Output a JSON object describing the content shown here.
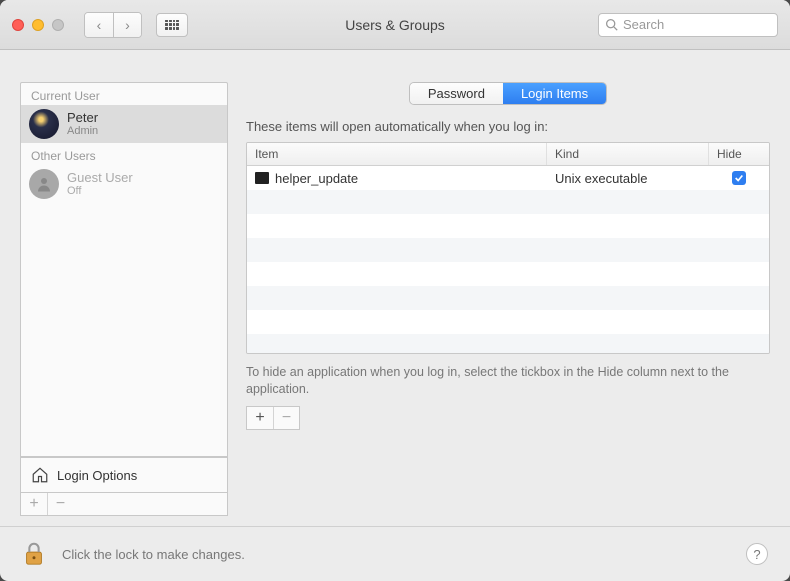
{
  "window": {
    "title": "Users & Groups",
    "search_placeholder": "Search"
  },
  "sidebar": {
    "current_label": "Current User",
    "other_label": "Other Users",
    "current_user": {
      "name": "Peter",
      "role": "Admin"
    },
    "other_users": [
      {
        "name": "Guest User",
        "status": "Off"
      }
    ],
    "login_options_label": "Login Options"
  },
  "tabs": {
    "password": "Password",
    "login_items": "Login Items",
    "active": "login_items"
  },
  "main": {
    "intro": "These items will open automatically when you log in:",
    "columns": {
      "item": "Item",
      "kind": "Kind",
      "hide": "Hide"
    },
    "rows": [
      {
        "item": "helper_update",
        "kind": "Unix executable",
        "hide": true
      }
    ],
    "hint": "To hide an application when you log in, select the tickbox in the Hide column next to the application."
  },
  "footer": {
    "lock_text": "Click the lock to make changes.",
    "help": "?"
  },
  "glyphs": {
    "plus": "+",
    "minus": "−",
    "back": "‹",
    "fwd": "›"
  }
}
